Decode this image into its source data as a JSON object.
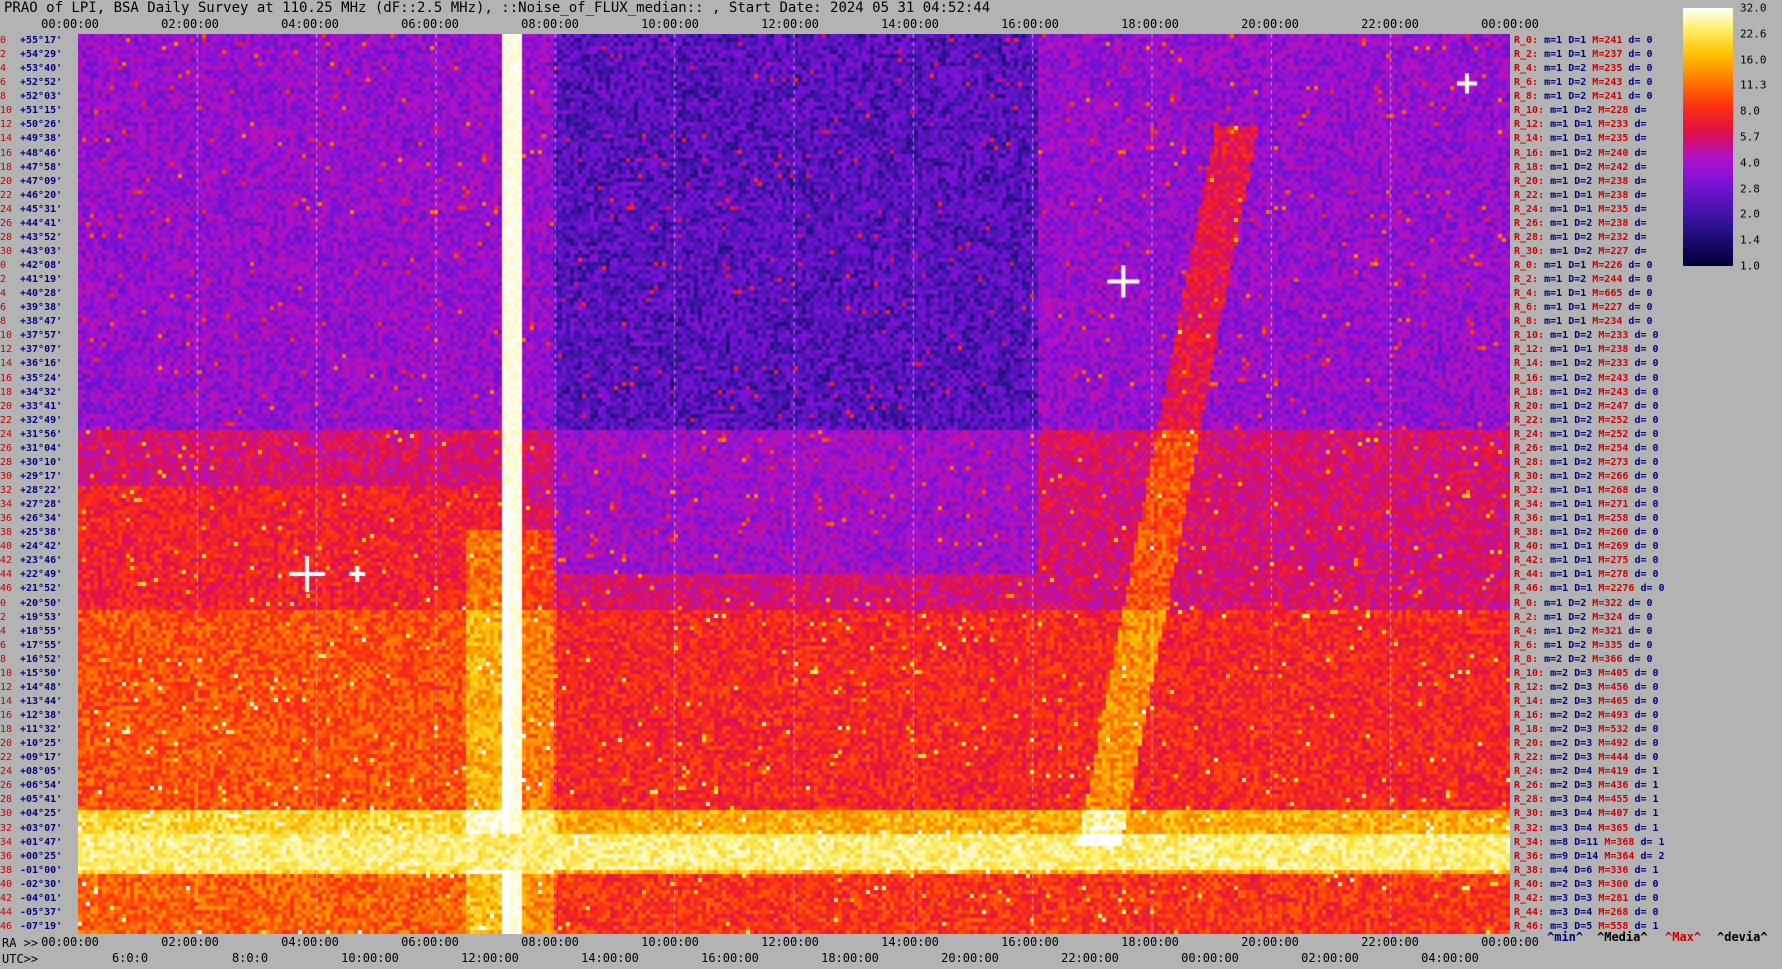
{
  "title": "PRAO of LPI, BSA Daily Survey at 110.25 MHz (dF::2.5 MHz), ::Noise_of_FLUX_median:: , Start Date: 2024 05 31 04:52:44",
  "ra_axis": {
    "prefix": "RA >>",
    "top_ticks": [
      "00:00:00",
      "02:00:00",
      "04:00:00",
      "06:00:00",
      "08:00:00",
      "10:00:00",
      "12:00:00",
      "14:00:00",
      "16:00:00",
      "18:00:00",
      "20:00:00",
      "22:00:00",
      "00:00:00"
    ],
    "bottom_ticks": [
      "00:00:00",
      "02:00:00",
      "04:00:00",
      "06:00:00",
      "08:00:00",
      "10:00:00",
      "12:00:00",
      "14:00:00",
      "16:00:00",
      "18:00:00",
      "20:00:00",
      "22:00:00",
      "00:00:00"
    ]
  },
  "utc_axis": {
    "prefix": "UTC>>",
    "ticks": [
      "6:0:0",
      "8:0:0",
      "10:00:00",
      "12:00:00",
      "14:00:00",
      "16:00:00",
      "18:00:00",
      "20:00:00",
      "22:00:00",
      "00:00:00",
      "02:00:00",
      "04:00:00"
    ]
  },
  "declinations": [
    {
      "idx": "0",
      "dec": "+55°17'"
    },
    {
      "idx": "2",
      "dec": "+54°29'"
    },
    {
      "idx": "4",
      "dec": "+53°40'"
    },
    {
      "idx": "6",
      "dec": "+52°52'"
    },
    {
      "idx": "8",
      "dec": "+52°03'"
    },
    {
      "idx": "10",
      "dec": "+51°15'"
    },
    {
      "idx": "12",
      "dec": "+50°26'"
    },
    {
      "idx": "14",
      "dec": "+49°38'"
    },
    {
      "idx": "16",
      "dec": "+48°46'"
    },
    {
      "idx": "18",
      "dec": "+47°58'"
    },
    {
      "idx": "20",
      "dec": "+47°09'"
    },
    {
      "idx": "22",
      "dec": "+46°20'"
    },
    {
      "idx": "24",
      "dec": "+45°31'"
    },
    {
      "idx": "26",
      "dec": "+44°41'"
    },
    {
      "idx": "28",
      "dec": "+43°52'"
    },
    {
      "idx": "30",
      "dec": "+43°03'"
    },
    {
      "idx": "0",
      "dec": "+42°08'"
    },
    {
      "idx": "2",
      "dec": "+41°19'"
    },
    {
      "idx": "4",
      "dec": "+40°28'"
    },
    {
      "idx": "6",
      "dec": "+39°38'"
    },
    {
      "idx": "8",
      "dec": "+38°47'"
    },
    {
      "idx": "10",
      "dec": "+37°57'"
    },
    {
      "idx": "12",
      "dec": "+37°07'"
    },
    {
      "idx": "14",
      "dec": "+36°16'"
    },
    {
      "idx": "16",
      "dec": "+35°24'"
    },
    {
      "idx": "18",
      "dec": "+34°32'"
    },
    {
      "idx": "20",
      "dec": "+33°41'"
    },
    {
      "idx": "22",
      "dec": "+32°49'"
    },
    {
      "idx": "24",
      "dec": "+31°56'"
    },
    {
      "idx": "26",
      "dec": "+31°04'"
    },
    {
      "idx": "28",
      "dec": "+30°10'"
    },
    {
      "idx": "30",
      "dec": "+29°17'"
    },
    {
      "idx": "32",
      "dec": "+28°22'"
    },
    {
      "idx": "34",
      "dec": "+27°28'"
    },
    {
      "idx": "36",
      "dec": "+26°34'"
    },
    {
      "idx": "38",
      "dec": "+25°38'"
    },
    {
      "idx": "40",
      "dec": "+24°42'"
    },
    {
      "idx": "42",
      "dec": "+23°46'"
    },
    {
      "idx": "44",
      "dec": "+22°49'"
    },
    {
      "idx": "46",
      "dec": "+21°52'"
    },
    {
      "idx": "0",
      "dec": "+20°50'"
    },
    {
      "idx": "2",
      "dec": "+19°53'"
    },
    {
      "idx": "4",
      "dec": "+18°55'"
    },
    {
      "idx": "6",
      "dec": "+17°55'"
    },
    {
      "idx": "8",
      "dec": "+16°52'"
    },
    {
      "idx": "10",
      "dec": "+15°50'"
    },
    {
      "idx": "12",
      "dec": "+14°48'"
    },
    {
      "idx": "14",
      "dec": "+13°44'"
    },
    {
      "idx": "16",
      "dec": "+12°38'"
    },
    {
      "idx": "18",
      "dec": "+11°32'"
    },
    {
      "idx": "20",
      "dec": "+10°25'"
    },
    {
      "idx": "22",
      "dec": "+09°17'"
    },
    {
      "idx": "24",
      "dec": "+08°05'"
    },
    {
      "idx": "26",
      "dec": "+06°54'"
    },
    {
      "idx": "28",
      "dec": "+05°41'"
    },
    {
      "idx": "30",
      "dec": "+04°25'"
    },
    {
      "idx": "32",
      "dec": "+03°07'"
    },
    {
      "idx": "34",
      "dec": "+01°47'"
    },
    {
      "idx": "36",
      "dec": "+00°25'"
    },
    {
      "idx": "38",
      "dec": "-01°00'"
    },
    {
      "idx": "40",
      "dec": "-02°30'"
    },
    {
      "idx": "42",
      "dec": "-04°01'"
    },
    {
      "idx": "44",
      "dec": "-05°37'"
    },
    {
      "idx": "46",
      "dec": "-07°19'"
    }
  ],
  "stats": [
    {
      "r": "R_0:",
      "m": "m=1",
      "D": "D=1",
      "M": "M=241",
      "d": "d= 0"
    },
    {
      "r": "R_2:",
      "m": "m=1",
      "D": "D=1",
      "M": "M=237",
      "d": "d= 0"
    },
    {
      "r": "R_4:",
      "m": "m=1",
      "D": "D=2",
      "M": "M=235",
      "d": "d= 0"
    },
    {
      "r": "R_6:",
      "m": "m=1",
      "D": "D=2",
      "M": "M=243",
      "d": "d= 0"
    },
    {
      "r": "R_8:",
      "m": "m=1",
      "D": "D=2",
      "M": "M=241",
      "d": "d= 0"
    },
    {
      "r": "R_10:",
      "m": "m=1",
      "D": "D=2",
      "M": "M=228",
      "d": "d="
    },
    {
      "r": "R_12:",
      "m": "m=1",
      "D": "D=1",
      "M": "M=233",
      "d": "d="
    },
    {
      "r": "R_14:",
      "m": "m=1",
      "D": "D=1",
      "M": "M=235",
      "d": "d="
    },
    {
      "r": "R_16:",
      "m": "m=1",
      "D": "D=2",
      "M": "M=240",
      "d": "d="
    },
    {
      "r": "R_18:",
      "m": "m=1",
      "D": "D=2",
      "M": "M=242",
      "d": "d="
    },
    {
      "r": "R_20:",
      "m": "m=1",
      "D": "D=2",
      "M": "M=238",
      "d": "d="
    },
    {
      "r": "R_22:",
      "m": "m=1",
      "D": "D=1",
      "M": "M=238",
      "d": "d="
    },
    {
      "r": "R_24:",
      "m": "m=1",
      "D": "D=1",
      "M": "M=235",
      "d": "d="
    },
    {
      "r": "R_26:",
      "m": "m=1",
      "D": "D=2",
      "M": "M=238",
      "d": "d="
    },
    {
      "r": "R_28:",
      "m": "m=1",
      "D": "D=2",
      "M": "M=232",
      "d": "d="
    },
    {
      "r": "R_30:",
      "m": "m=1",
      "D": "D=2",
      "M": "M=227",
      "d": "d="
    },
    {
      "r": "R_0:",
      "m": "m=1",
      "D": "D=1",
      "M": "M=226",
      "d": "d= 0"
    },
    {
      "r": "R_2:",
      "m": "m=1",
      "D": "D=2",
      "M": "M=244",
      "d": "d= 0"
    },
    {
      "r": "R_4:",
      "m": "m=1",
      "D": "D=1",
      "M": "M=665",
      "d": "d= 0"
    },
    {
      "r": "R_6:",
      "m": "m=1",
      "D": "D=1",
      "M": "M=227",
      "d": "d= 0"
    },
    {
      "r": "R_8:",
      "m": "m=1",
      "D": "D=1",
      "M": "M=234",
      "d": "d= 0"
    },
    {
      "r": "R_10:",
      "m": "m=1",
      "D": "D=2",
      "M": "M=233",
      "d": "d= 0"
    },
    {
      "r": "R_12:",
      "m": "m=1",
      "D": "D=1",
      "M": "M=238",
      "d": "d= 0"
    },
    {
      "r": "R_14:",
      "m": "m=1",
      "D": "D=2",
      "M": "M=233",
      "d": "d= 0"
    },
    {
      "r": "R_16:",
      "m": "m=1",
      "D": "D=2",
      "M": "M=243",
      "d": "d= 0"
    },
    {
      "r": "R_18:",
      "m": "m=1",
      "D": "D=2",
      "M": "M=243",
      "d": "d= 0"
    },
    {
      "r": "R_20:",
      "m": "m=1",
      "D": "D=2",
      "M": "M=247",
      "d": "d= 0"
    },
    {
      "r": "R_22:",
      "m": "m=1",
      "D": "D=2",
      "M": "M=252",
      "d": "d= 0"
    },
    {
      "r": "R_24:",
      "m": "m=1",
      "D": "D=2",
      "M": "M=252",
      "d": "d= 0"
    },
    {
      "r": "R_26:",
      "m": "m=1",
      "D": "D=2",
      "M": "M=254",
      "d": "d= 0"
    },
    {
      "r": "R_28:",
      "m": "m=1",
      "D": "D=2",
      "M": "M=273",
      "d": "d= 0"
    },
    {
      "r": "R_30:",
      "m": "m=1",
      "D": "D=2",
      "M": "M=266",
      "d": "d= 0"
    },
    {
      "r": "R_32:",
      "m": "m=1",
      "D": "D=1",
      "M": "M=268",
      "d": "d= 0"
    },
    {
      "r": "R_34:",
      "m": "m=1",
      "D": "D=1",
      "M": "M=271",
      "d": "d= 0"
    },
    {
      "r": "R_36:",
      "m": "m=1",
      "D": "D=1",
      "M": "M=258",
      "d": "d= 0"
    },
    {
      "r": "R_38:",
      "m": "m=1",
      "D": "D=2",
      "M": "M=260",
      "d": "d= 0"
    },
    {
      "r": "R_40:",
      "m": "m=1",
      "D": "D=1",
      "M": "M=269",
      "d": "d= 0"
    },
    {
      "r": "R_42:",
      "m": "m=1",
      "D": "D=1",
      "M": "M=275",
      "d": "d= 0"
    },
    {
      "r": "R_44:",
      "m": "m=1",
      "D": "D=1",
      "M": "M=278",
      "d": "d= 0"
    },
    {
      "r": "R_46:",
      "m": "m=1",
      "D": "D=1",
      "M": "M=2276",
      "d": "d= 0"
    },
    {
      "r": "R_0:",
      "m": "m=1",
      "D": "D=2",
      "M": "M=322",
      "d": "d= 0"
    },
    {
      "r": "R_2:",
      "m": "m=1",
      "D": "D=2",
      "M": "M=324",
      "d": "d= 0"
    },
    {
      "r": "R_4:",
      "m": "m=1",
      "D": "D=2",
      "M": "M=321",
      "d": "d= 0"
    },
    {
      "r": "R_6:",
      "m": "m=1",
      "D": "D=2",
      "M": "M=335",
      "d": "d= 0"
    },
    {
      "r": "R_8:",
      "m": "m=2",
      "D": "D=2",
      "M": "M=366",
      "d": "d= 0"
    },
    {
      "r": "R_10:",
      "m": "m=2",
      "D": "D=3",
      "M": "M=405",
      "d": "d= 0"
    },
    {
      "r": "R_12:",
      "m": "m=2",
      "D": "D=3",
      "M": "M=456",
      "d": "d= 0"
    },
    {
      "r": "R_14:",
      "m": "m=2",
      "D": "D=3",
      "M": "M=465",
      "d": "d= 0"
    },
    {
      "r": "R_16:",
      "m": "m=2",
      "D": "D=2",
      "M": "M=493",
      "d": "d= 0"
    },
    {
      "r": "R_18:",
      "m": "m=2",
      "D": "D=3",
      "M": "M=532",
      "d": "d= 0"
    },
    {
      "r": "R_20:",
      "m": "m=2",
      "D": "D=3",
      "M": "M=492",
      "d": "d= 0"
    },
    {
      "r": "R_22:",
      "m": "m=2",
      "D": "D=3",
      "M": "M=444",
      "d": "d= 0"
    },
    {
      "r": "R_24:",
      "m": "m=2",
      "D": "D=4",
      "M": "M=419",
      "d": "d= 1"
    },
    {
      "r": "R_26:",
      "m": "m=2",
      "D": "D=3",
      "M": "M=436",
      "d": "d= 1"
    },
    {
      "r": "R_28:",
      "m": "m=3",
      "D": "D=4",
      "M": "M=455",
      "d": "d= 1"
    },
    {
      "r": "R_30:",
      "m": "m=3",
      "D": "D=4",
      "M": "M=407",
      "d": "d= 1"
    },
    {
      "r": "R_32:",
      "m": "m=3",
      "D": "D=4",
      "M": "M=365",
      "d": "d= 1"
    },
    {
      "r": "R_34:",
      "m": "m=8",
      "D": "D=11",
      "M": "M=368",
      "d": "d= 1"
    },
    {
      "r": "R_36:",
      "m": "m=9",
      "D": "D=14",
      "M": "M=364",
      "d": "d= 2"
    },
    {
      "r": "R_38:",
      "m": "m=4",
      "D": "D=6",
      "M": "M=336",
      "d": "d= 1"
    },
    {
      "r": "R_40:",
      "m": "m=2",
      "D": "D=3",
      "M": "M=300",
      "d": "d= 0"
    },
    {
      "r": "R_42:",
      "m": "m=3",
      "D": "D=3",
      "M": "M=281",
      "d": "d= 0"
    },
    {
      "r": "R_44:",
      "m": "m=3",
      "D": "D=4",
      "M": "M=268",
      "d": "d= 0"
    },
    {
      "r": "R_46:",
      "m": "m=3",
      "D": "D=5",
      "M": "M=558",
      "d": "d= 1"
    }
  ],
  "colorbar": {
    "labels": [
      "32.0",
      "22.6",
      "16.0",
      "11.3",
      "8.0",
      "5.7",
      "4.0",
      "2.8",
      "2.0",
      "1.4",
      "1.0"
    ]
  },
  "legend": {
    "min": "^min^",
    "median": "^Media^",
    "max": "^Max^",
    "devia": "^devia^"
  },
  "chart_data": {
    "type": "heatmap",
    "title": "PRAO of LPI, BSA Daily Survey at 110.25 MHz (dF::2.5 MHz), ::Noise_of_FLUX_median:: , Start Date: 2024 05 31 04:52:44",
    "xlabel": "RA",
    "ylabel": "",
    "x_range_hours": [
      0,
      24
    ],
    "colorscale_range": [
      1.0,
      32.0
    ],
    "colorscale_log": true,
    "colors": [
      "#000033",
      "#3e14a8",
      "#7a12d6",
      "#b012c8",
      "#e0104a",
      "#ff3010",
      "#ff7a00",
      "#ffc000",
      "#fff06a",
      "#ffffff"
    ]
  }
}
